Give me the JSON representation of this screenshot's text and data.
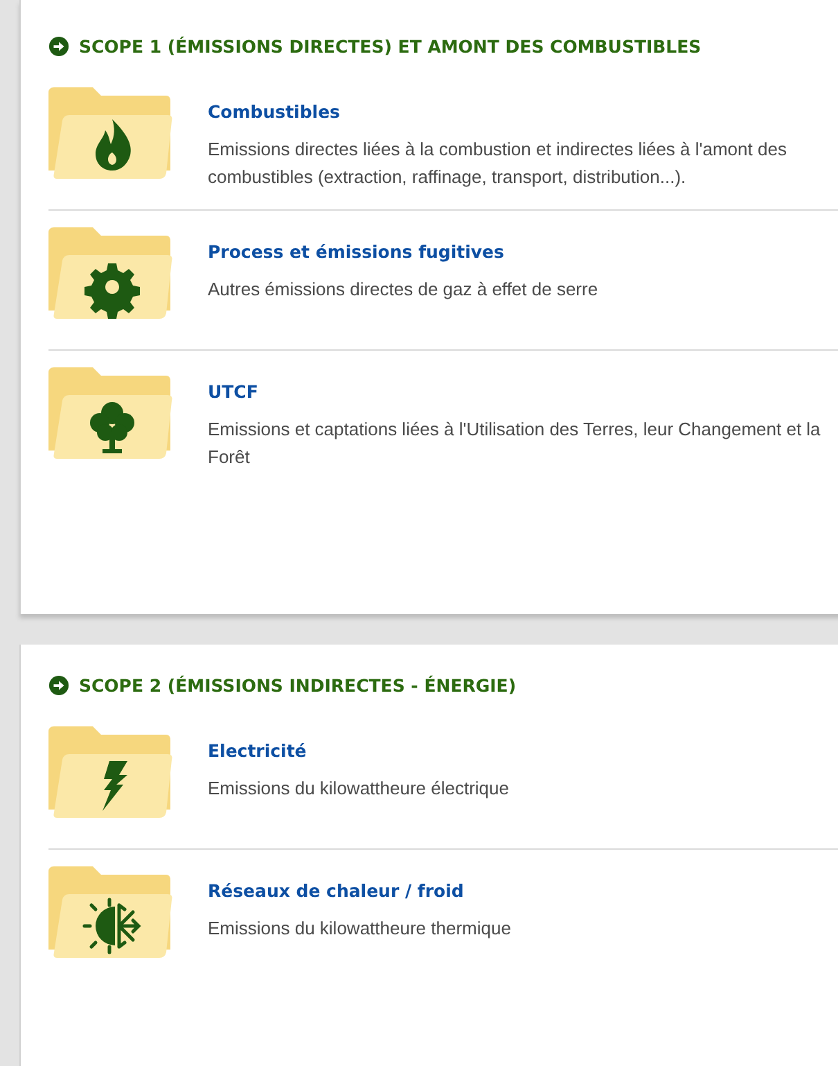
{
  "sections": [
    {
      "title": "SCOPE 1 (ÉMISSIONS DIRECTES) ET AMONT DES COMBUSTIBLES",
      "items": [
        {
          "kind": "flame",
          "title": "Combustibles",
          "description": "Emissions directes liées à la combustion et indirectes liées à l'amont des combustibles (extraction, raffinage, transport, distribution...)."
        },
        {
          "kind": "gear",
          "title": "Process et émissions fugitives",
          "description": "Autres émissions directes de gaz à effet de serre"
        },
        {
          "kind": "tree",
          "title": "UTCF",
          "description": "Emissions et captations liées à l'Utilisation des Terres, leur Changement et la Forêt"
        }
      ]
    },
    {
      "title": "SCOPE 2 (ÉMISSIONS INDIRECTES - ÉNERGIE)",
      "items": [
        {
          "kind": "bolt",
          "title": "Electricité",
          "description": "Emissions du kilowattheure électrique"
        },
        {
          "kind": "heatcold",
          "title": "Réseaux de chaleur / froid",
          "description": "Emissions du kilowattheure thermique"
        }
      ]
    }
  ]
}
